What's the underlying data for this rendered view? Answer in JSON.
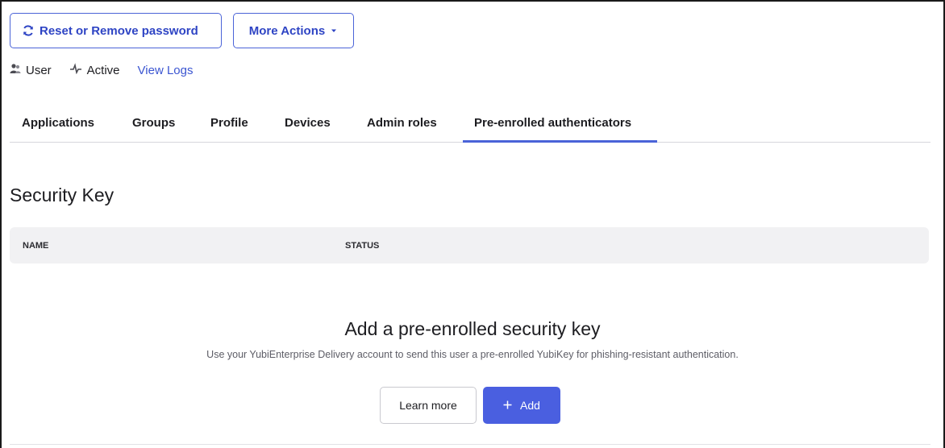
{
  "actions": {
    "reset_label": "Reset or Remove password",
    "more_label": "More Actions",
    "reset_icon": "refresh-icon",
    "more_icon": "caret-down-icon"
  },
  "meta": {
    "type_label": "User",
    "type_icon": "user-icon",
    "status_label": "Active",
    "status_icon": "activity-icon",
    "logs_link": "View Logs"
  },
  "tabs": [
    {
      "label": "Applications"
    },
    {
      "label": "Groups"
    },
    {
      "label": "Profile"
    },
    {
      "label": "Devices"
    },
    {
      "label": "Admin roles"
    },
    {
      "label": "Pre-enrolled authenticators",
      "active": true
    }
  ],
  "security_key": {
    "title": "Security Key",
    "columns": [
      "NAME",
      "STATUS"
    ],
    "empty_title": "Add a pre-enrolled security key",
    "empty_description": "Use your YubiEnterprise Delivery account to send this user a pre-enrolled YubiKey for phishing-resistant authentication.",
    "learn_more_label": "Learn more",
    "add_label": "Add",
    "add_icon": "plus-icon"
  },
  "colors": {
    "accent": "#4a63d8",
    "primary_button": "#4a5fe0",
    "link": "#3b55d1"
  }
}
